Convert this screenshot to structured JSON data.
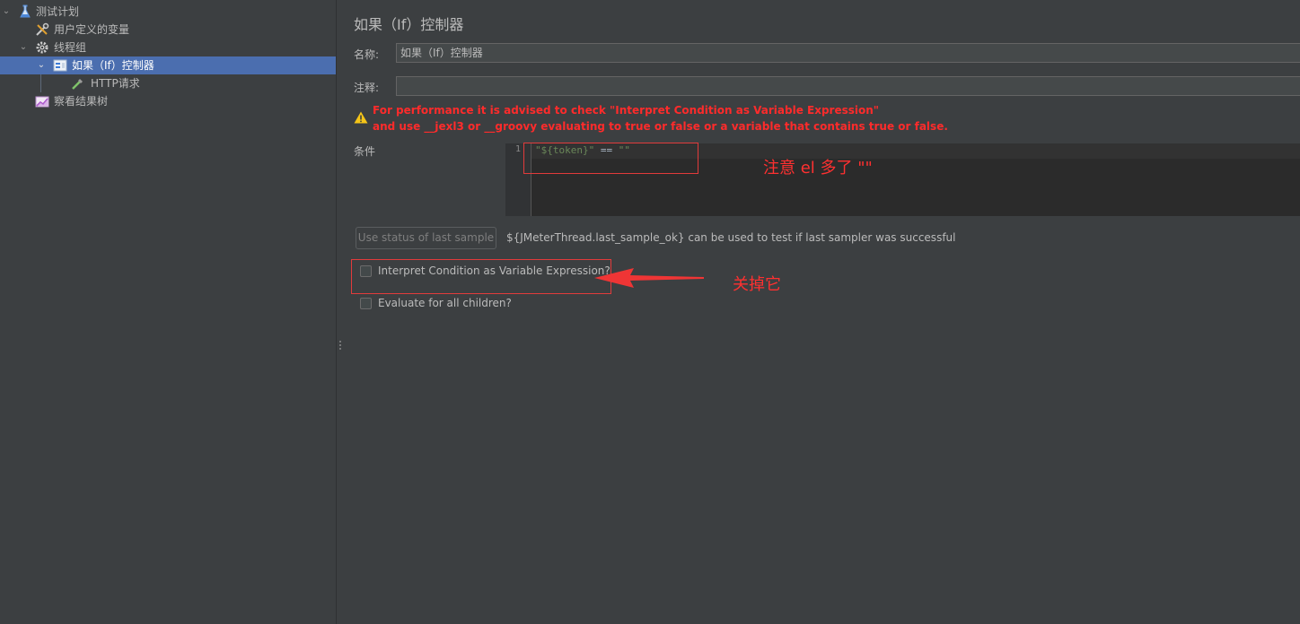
{
  "tree": {
    "items": [
      {
        "label": "测试计划",
        "icon": "flask-icon"
      },
      {
        "label": "用户定义的变量",
        "icon": "tools-icon"
      },
      {
        "label": "线程组",
        "icon": "gear-icon"
      },
      {
        "label": "如果（If）控制器",
        "icon": "controller-icon",
        "selected": true
      },
      {
        "label": "HTTP请求",
        "icon": "pipette-icon"
      },
      {
        "label": "察看结果树",
        "icon": "chart-icon"
      }
    ],
    "selected_color": "#4b6eaf"
  },
  "panel": {
    "title": "如果（If）控制器",
    "name_label": "名称:",
    "name_value": "如果（If）控制器",
    "comment_label": "注释:",
    "comment_value": "",
    "warning_line1": "For performance it is advised to check \"Interpret Condition as Variable Expression\"",
    "warning_line2": "and use __jexl3 or __groovy evaluating to true or false or a variable that contains true or false.",
    "warning_color": "#ff2b2b",
    "condition_label": "条件",
    "editor": {
      "line_number": "1",
      "code_str1": "\"${token}\"",
      "code_op": " == ",
      "code_str2": "\"\""
    },
    "status_button": "Use status of last sample",
    "status_hint": "${JMeterThread.last_sample_ok} can be used to test if last sampler was successful",
    "checkbox_interpret": {
      "label": "Interpret Condition as Variable Expression?",
      "checked": false
    },
    "checkbox_evaluate": {
      "label": "Evaluate for all children?",
      "checked": false
    }
  },
  "annotations": {
    "note_editor": "注意 el 多了 \"\"",
    "note_checkbox": "关掉它",
    "color": "#ff3030"
  }
}
